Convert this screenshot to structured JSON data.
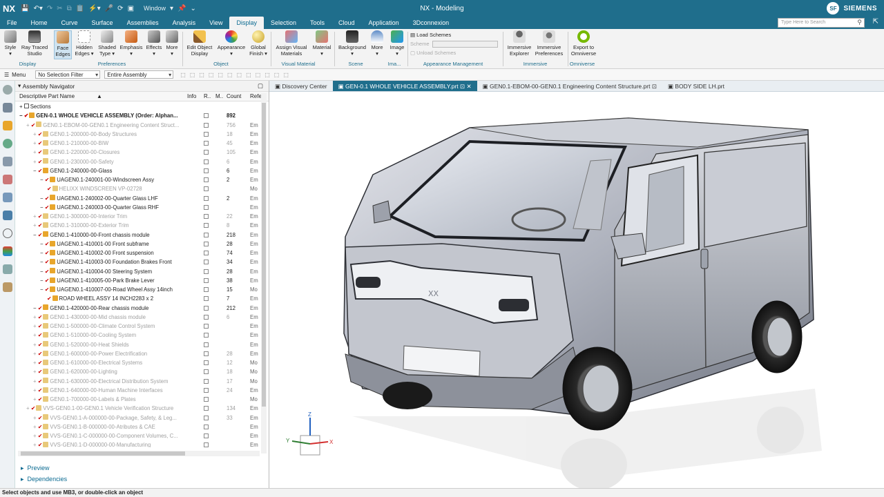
{
  "app": {
    "logo": "NX",
    "window_menu": "Window",
    "title": "NX - Modeling",
    "user_initials": "SF",
    "brand": "SIEMENS"
  },
  "menu": {
    "tabs": [
      "File",
      "Home",
      "Curve",
      "Surface",
      "Assemblies",
      "Analysis",
      "View",
      "Display",
      "Selection",
      "Tools",
      "Cloud",
      "Application",
      "3Dconnexion"
    ],
    "active": "Display",
    "search_placeholder": "Type Here to Search"
  },
  "ribbon": {
    "buttons": [
      "Style",
      "Ray Traced Studio",
      "Face Edges",
      "Hidden Edges",
      "Shaded Type",
      "Emphasis",
      "Effects",
      "More",
      "Edit Object Display",
      "Appearance",
      "Global Finish",
      "Assign Visual Materials",
      "Material",
      "Background",
      "More",
      "Image",
      "Immersive Explorer",
      "Immersive Preferences",
      "Export to Omniverse"
    ],
    "groups": [
      "Display",
      "Preferences",
      "Object",
      "Visual Material",
      "Scene",
      "Ima...",
      "Appearance Management",
      "Immersive",
      "Omniverse"
    ],
    "schemes": {
      "load": "Load Schemes",
      "scheme_label": "Scheme",
      "unload": "Unload Schemes"
    },
    "colors": {
      "accent": "#1f6e8c",
      "active_bg": "#cfe3f0"
    }
  },
  "toolbar2": {
    "menu": "Menu",
    "filter": "No Selection Filter",
    "scope": "Entire Assembly"
  },
  "navigator": {
    "title": "Assembly Navigator",
    "columns": [
      "Descriptive Part Name",
      "Info",
      "R..",
      "M..",
      "Count",
      "Refer"
    ],
    "rows": [
      {
        "indent": 0,
        "text": "Sections",
        "count": "",
        "ref": "",
        "style": "norm",
        "kind": "section"
      },
      {
        "indent": 0,
        "text": "GEN-0.1 WHOLE VEHICLE ASSEMBLY (Order: Alphan...",
        "count": "892",
        "ref": "",
        "style": "bold"
      },
      {
        "indent": 1,
        "text": "GEN0.1-EBOM-00-GEN0.1 Engineering Content Struct...",
        "count": "756",
        "ref": "Em",
        "style": "dim"
      },
      {
        "indent": 2,
        "text": "GEN0.1-200000-00-Body Structures",
        "count": "18",
        "ref": "Em",
        "style": "dim"
      },
      {
        "indent": 2,
        "text": "GEN0.1-210000-00-BIW",
        "count": "45",
        "ref": "Em",
        "style": "dim"
      },
      {
        "indent": 2,
        "text": "GEN0.1-220000-00-Closures",
        "count": "105",
        "ref": "Em",
        "style": "dim"
      },
      {
        "indent": 2,
        "text": "GEN0.1-230000-00-Safety",
        "count": "6",
        "ref": "Em",
        "style": "dim"
      },
      {
        "indent": 2,
        "text": "GEN0.1-240000-00-Glass",
        "count": "6",
        "ref": "Em",
        "style": "norm"
      },
      {
        "indent": 3,
        "text": "UAGEN0.1-240001-00-Windscreen Assy",
        "count": "2",
        "ref": "Em",
        "style": "norm"
      },
      {
        "indent": 4,
        "text": "HELIXX WINDSCREEN VP-02728",
        "count": "",
        "ref": "Mo",
        "style": "dim"
      },
      {
        "indent": 3,
        "text": "UAGEN0.1-240002-00-Quarter Glass LHF",
        "count": "2",
        "ref": "Em",
        "style": "norm"
      },
      {
        "indent": 3,
        "text": "UAGEN0.1-240003-00-Quarter Glass RHF",
        "count": "",
        "ref": "Em",
        "style": "norm"
      },
      {
        "indent": 2,
        "text": "GEN0.1-300000-00-Interior Trim",
        "count": "22",
        "ref": "Em",
        "style": "dim"
      },
      {
        "indent": 2,
        "text": "GEN0.1-310000-00-Exterior Trim",
        "count": "8",
        "ref": "Em",
        "style": "dim"
      },
      {
        "indent": 2,
        "text": "GEN0.1-410000-00-Front chassis module",
        "count": "218",
        "ref": "Em",
        "style": "norm"
      },
      {
        "indent": 3,
        "text": "UAGEN0.1-410001-00 Front subframe",
        "count": "28",
        "ref": "Em",
        "style": "norm"
      },
      {
        "indent": 3,
        "text": "UAGEN0.1-410002-00 Front suspension",
        "count": "74",
        "ref": "Em",
        "style": "norm"
      },
      {
        "indent": 3,
        "text": "UAGEN0.1-410003-00 Foundation Brakes Front",
        "count": "34",
        "ref": "Em",
        "style": "norm"
      },
      {
        "indent": 3,
        "text": "UAGEN0.1-410004-00 Steering System",
        "count": "28",
        "ref": "Em",
        "style": "norm"
      },
      {
        "indent": 3,
        "text": "UAGEN0.1-410005-00-Park Brake Lever",
        "count": "38",
        "ref": "Em",
        "style": "norm"
      },
      {
        "indent": 3,
        "text": "UAGEN0.1-410007-00-Road Wheel Assy 14inch",
        "count": "15",
        "ref": "Mo",
        "style": "norm"
      },
      {
        "indent": 4,
        "text": "ROAD WHEEL ASSY 14 INCH2283 x 2",
        "count": "7",
        "ref": "Em",
        "style": "norm"
      },
      {
        "indent": 2,
        "text": "GEN0.1-420000-00-Rear chassis module",
        "count": "212",
        "ref": "Em",
        "style": "norm"
      },
      {
        "indent": 2,
        "text": "GEN0.1-430000-00-Mid chassis module",
        "count": "6",
        "ref": "Em",
        "style": "dim"
      },
      {
        "indent": 2,
        "text": "GEN0.1-500000-00-Climate Control System",
        "count": "",
        "ref": "Em",
        "style": "dim"
      },
      {
        "indent": 2,
        "text": "GEN0.1-510000-00-Cooling System",
        "count": "",
        "ref": "Em",
        "style": "dim"
      },
      {
        "indent": 2,
        "text": "GEN0.1-520000-00-Heat Shields",
        "count": "",
        "ref": "Em",
        "style": "dim"
      },
      {
        "indent": 2,
        "text": "GEN0.1-600000-00-Power Electrification",
        "count": "28",
        "ref": "Em",
        "style": "dim"
      },
      {
        "indent": 2,
        "text": "GEN0.1-610000-00-Electrical Systems",
        "count": "12",
        "ref": "Mo",
        "style": "dim"
      },
      {
        "indent": 2,
        "text": "GEN0.1-620000-00-Lighting",
        "count": "18",
        "ref": "Mo",
        "style": "dim"
      },
      {
        "indent": 2,
        "text": "GEN0.1-630000-00-Electrical Distribution System",
        "count": "17",
        "ref": "Mo",
        "style": "dim"
      },
      {
        "indent": 2,
        "text": "GEN0.1-640000-00-Human Machine Interfaces",
        "count": "24",
        "ref": "Em",
        "style": "dim"
      },
      {
        "indent": 2,
        "text": "GEN0.1-700000-00-Labels & Plates",
        "count": "",
        "ref": "Mo",
        "style": "dim"
      },
      {
        "indent": 1,
        "text": "VVS-GEN0.1-00-GEN0.1 Vehicle Verification Structure",
        "count": "134",
        "ref": "Em",
        "style": "dim"
      },
      {
        "indent": 2,
        "text": "VVS-GEN0.1-A-000000-00-Package, Safety, & Leg...",
        "count": "33",
        "ref": "Em",
        "style": "dim"
      },
      {
        "indent": 2,
        "text": "VVS-GEN0.1-B-000000-00-Atributes & CAE",
        "count": "",
        "ref": "Em",
        "style": "dim"
      },
      {
        "indent": 2,
        "text": "VVS-GEN0.1-C-000000-00-Component Volumes, C...",
        "count": "",
        "ref": "Em",
        "style": "dim"
      },
      {
        "indent": 2,
        "text": "VVS-GEN0.1-D-000000-00-Manufacturing",
        "count": "",
        "ref": "Em",
        "style": "dim"
      }
    ],
    "panels": [
      "Preview",
      "Dependencies"
    ]
  },
  "doctabs": [
    "Discovery Center",
    "GEN-0.1 WHOLE VEHICLE ASSEMBLY.prt",
    "GEN0.1-EBOM-00-GEN0.1 Engineering Content Structure.prt",
    "BODY SIDE LH.prt"
  ],
  "active_doctab": 1,
  "viewport": {
    "badge": "XX",
    "axis_z": "Z",
    "axis_y": "Y",
    "axis_x": "X"
  },
  "status": "Select objects and use MB3, or double-click an object"
}
